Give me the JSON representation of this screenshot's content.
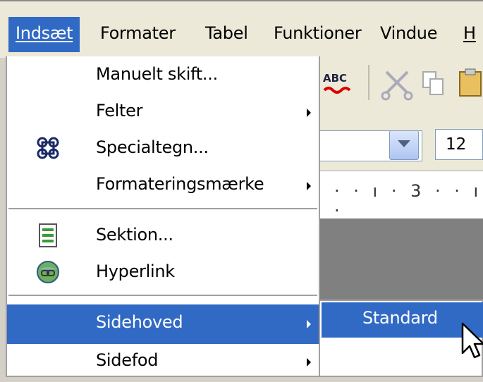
{
  "menubar": {
    "items": [
      {
        "label": "Indsæt",
        "underline": "I",
        "active": true
      },
      {
        "label": "Formater",
        "underline": "t"
      },
      {
        "label": "Tabel",
        "underline": "b"
      },
      {
        "label": "Funktioner",
        "underline": "k"
      },
      {
        "label": "Vindue",
        "underline": "u"
      },
      {
        "label": "H",
        "underline": "H"
      }
    ]
  },
  "insert_menu": {
    "items": [
      {
        "label": "Manuelt skift...",
        "has_submenu": false,
        "icon": null
      },
      {
        "label": "Felter",
        "has_submenu": true,
        "icon": null
      },
      {
        "label": "Specialtegn...",
        "has_submenu": false,
        "icon": "special-character-icon"
      },
      {
        "label": "Formateringsmærke",
        "has_submenu": true,
        "icon": null
      },
      {
        "label": "Sektion...",
        "has_submenu": false,
        "icon": "section-icon"
      },
      {
        "label": "Hyperlink",
        "has_submenu": false,
        "icon": "hyperlink-globe-icon"
      },
      {
        "label": "Sidehoved",
        "has_submenu": true,
        "icon": null,
        "highlighted": true
      },
      {
        "label": "Sidefod",
        "has_submenu": true,
        "icon": null
      }
    ]
  },
  "header_submenu": {
    "items": [
      {
        "label": "Standard",
        "highlighted": true
      }
    ]
  },
  "toolbar": {
    "spellcheck_label": "ABC",
    "font_size_value": "12"
  },
  "ruler": {
    "text": "· · ı · 3 · · ı ·"
  },
  "colors": {
    "highlight": "#316ac5",
    "menu_background": "#ffffff",
    "menubar_background": "#ece9d8",
    "document_gray": "#808080"
  }
}
